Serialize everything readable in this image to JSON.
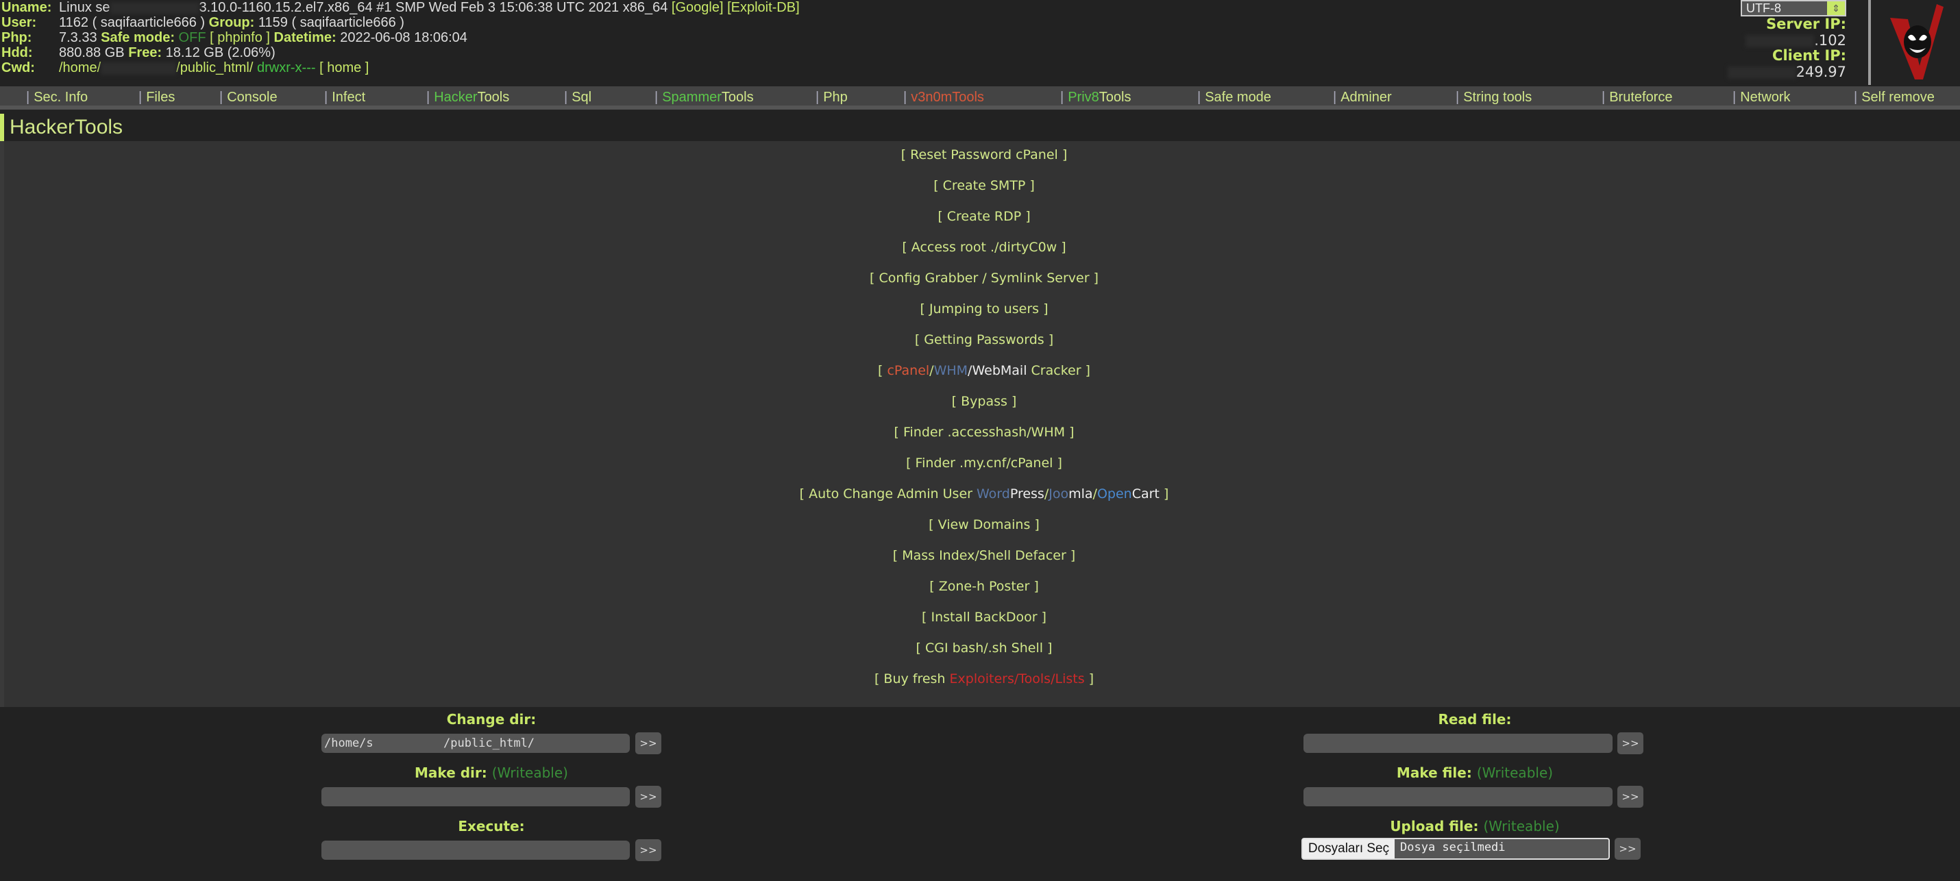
{
  "header": {
    "uname_label": "Uname:",
    "uname_prefix": "Linux se",
    "uname_value": "3.10.0-1160.15.2.el7.x86_64 #1 SMP Wed Feb 3 15:06:38 UTC 2021 x86_64",
    "google": "[Google]",
    "exploitdb": "[Exploit-DB]",
    "user_label": "User:",
    "user_value": "1162 ( saqifaarticle666 )",
    "group_label": "Group:",
    "group_value": "1159 ( saqifaarticle666 )",
    "php_label": "Php:",
    "php_value": "7.3.33",
    "safe_label": "Safe mode:",
    "safe_value": "OFF",
    "phpinfo": "[ phpinfo ]",
    "datetime_label": "Datetime:",
    "datetime_value": "2022-06-08 18:06:04",
    "hdd_label": "Hdd:",
    "hdd_value": "880.88 GB",
    "free_label": "Free:",
    "free_value": "18.12 GB (2.06%)",
    "cwd_label": "Cwd:",
    "cwd_prefix": "/home/",
    "cwd_suffix": "/public_html/",
    "cwd_perms": "drwxr-x---",
    "cwd_home": "[ home ]",
    "encoding": "UTF-8",
    "server_ip_label": "Server IP:",
    "server_ip": ".102",
    "client_ip_label": "Client IP:",
    "client_ip": "249.97"
  },
  "menu": [
    {
      "label": "Sec. Info"
    },
    {
      "label": "Files"
    },
    {
      "label": "Console"
    },
    {
      "label": "Infect"
    },
    {
      "label_a": "Hacker",
      "label_b": "Tools"
    },
    {
      "label": "Sql"
    },
    {
      "label_a": "Spammer",
      "label_b": "Tools"
    },
    {
      "label": "Php"
    },
    {
      "label": "v3n0mTools"
    },
    {
      "label_a": "Priv8",
      "label_b": "Tools"
    },
    {
      "label": "Safe mode"
    },
    {
      "label": "Adminer"
    },
    {
      "label": "String tools"
    },
    {
      "label": "Bruteforce"
    },
    {
      "label": "Network"
    },
    {
      "label": "Self remove"
    }
  ],
  "page_title": "HackerTools",
  "tools": [
    "[ Reset Password cPanel ]",
    "[ Create SMTP ]",
    "[ Create RDP ]",
    "[ Access root ./dirtyC0w ]",
    "[ Config Grabber / Symlink Server ]",
    "[ Jumping to users ]",
    "[ Getting Passwords ]"
  ],
  "cracker": {
    "open": "[ ",
    "cpanel": "cPanel",
    "s1": "/",
    "whm": "WHM",
    "s2": "/",
    "webmail": "WebMail",
    "rest": " Cracker ]"
  },
  "tools2": [
    "[ Bypass ]",
    "[ Finder .accesshash/WHM ]",
    "[ Finder .my.cnf/cPanel ]"
  ],
  "autochange": {
    "pre": "[ Auto Change Admin User ",
    "word": "Word",
    "press": "Press",
    "s1": "/",
    "joo": "Joo",
    "mla": "mla",
    "s2": "/",
    "open": "Open",
    "cart": "Cart",
    "post": " ]"
  },
  "tools3": [
    "[ View Domains ]",
    "[ Mass Index/Shell Defacer ]",
    "[ Zone-h Poster ]",
    "[ Install BackDoor ]",
    "[ CGI bash/.sh Shell ]"
  ],
  "buy": {
    "pre": "[ Buy fresh ",
    "link": "Exploiters/Tools/Lists",
    "post": " ]"
  },
  "forms": {
    "change_dir": "Change dir:",
    "change_dir_value": "/home/s          /public_html/",
    "make_dir": "Make dir:",
    "writeable": "(Writeable)",
    "execute": "Execute:",
    "read_file": "Read file:",
    "make_file": "Make file:",
    "upload_file": "Upload file:",
    "choose_files": "Dosyaları Seç",
    "no_file": "Dosya seçilmedi",
    "go": ">>"
  },
  "colors": {
    "accent": "#c8e868",
    "bg": "#222222",
    "panel": "#333333",
    "menu": "#444444",
    "danger": "#d02a2a",
    "ok": "#3a8f3a"
  }
}
